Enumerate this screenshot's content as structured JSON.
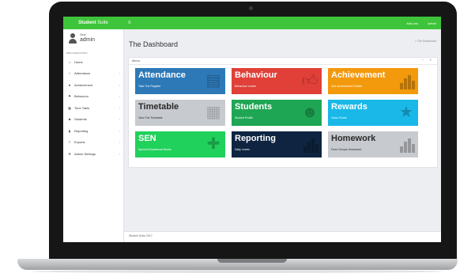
{
  "app": {
    "brand_bold": "Student",
    "brand_light": "Suite",
    "menu_toggle": "≡",
    "top_right": [
      "Add-ons",
      "admin"
    ]
  },
  "user": {
    "view_label": "View",
    "name": "admin"
  },
  "sidebar": {
    "section_label": "MAIN NAVIGATION",
    "items": [
      {
        "label": "Home",
        "icon": "home-icon",
        "has_children": false
      },
      {
        "label": "Attendance",
        "icon": "check-icon",
        "has_children": true
      },
      {
        "label": "Achievement",
        "icon": "star-icon",
        "has_children": true
      },
      {
        "label": "Behaviour",
        "icon": "flag-icon",
        "has_children": true
      },
      {
        "label": "Time Table",
        "icon": "calendar-icon",
        "has_children": true
      },
      {
        "label": "Students",
        "icon": "users-icon",
        "has_children": true
      },
      {
        "label": "Reporting",
        "icon": "chart-icon",
        "has_children": true
      },
      {
        "label": "Exports",
        "icon": "export-icon",
        "has_children": true
      },
      {
        "label": "Admin Settings",
        "icon": "gear-icon",
        "has_children": true
      }
    ]
  },
  "page": {
    "title": "The Dashboard",
    "breadcrumb": "The Dashboard"
  },
  "panel": {
    "title": "Menu",
    "tools": "− ×"
  },
  "tiles": [
    {
      "title": "Attendance",
      "sub": "Take The Register",
      "color": "#2d79b8",
      "icon": "clipboard-icon",
      "dark": false
    },
    {
      "title": "Behaviour",
      "sub": "Behaviour Levels",
      "color": "#e04038",
      "icon": "thumbs-up-icon",
      "dark": false
    },
    {
      "title": "Achievement",
      "sub": "Add Achievement Details",
      "color": "#f3990c",
      "icon": "bar-chart-icon",
      "dark": false
    },
    {
      "title": "Timetable",
      "sub": "View The Timetable",
      "color": "#c7cacf",
      "icon": "calendar-icon",
      "dark": true
    },
    {
      "title": "Students",
      "sub": "Student Profile",
      "color": "#1fa654",
      "icon": "add-user-icon",
      "dark": false
    },
    {
      "title": "Rewards",
      "sub": "Class Points",
      "color": "#1ab8e8",
      "icon": "star-icon",
      "dark": false
    },
    {
      "title": "SEN",
      "sub": "Special Educational Needs",
      "color": "#20d15b",
      "icon": "medkit-icon",
      "dark": false
    },
    {
      "title": "Reporting",
      "sub": "Daily Levels",
      "color": "#0e2440",
      "icon": "bar-chart-icon",
      "dark": false
    },
    {
      "title": "Homework",
      "sub": "Form Groups Homework",
      "color": "#c7cacf",
      "icon": "bar-chart-icon",
      "dark": true
    }
  ],
  "footer": {
    "text": "Student Suite 2017"
  }
}
